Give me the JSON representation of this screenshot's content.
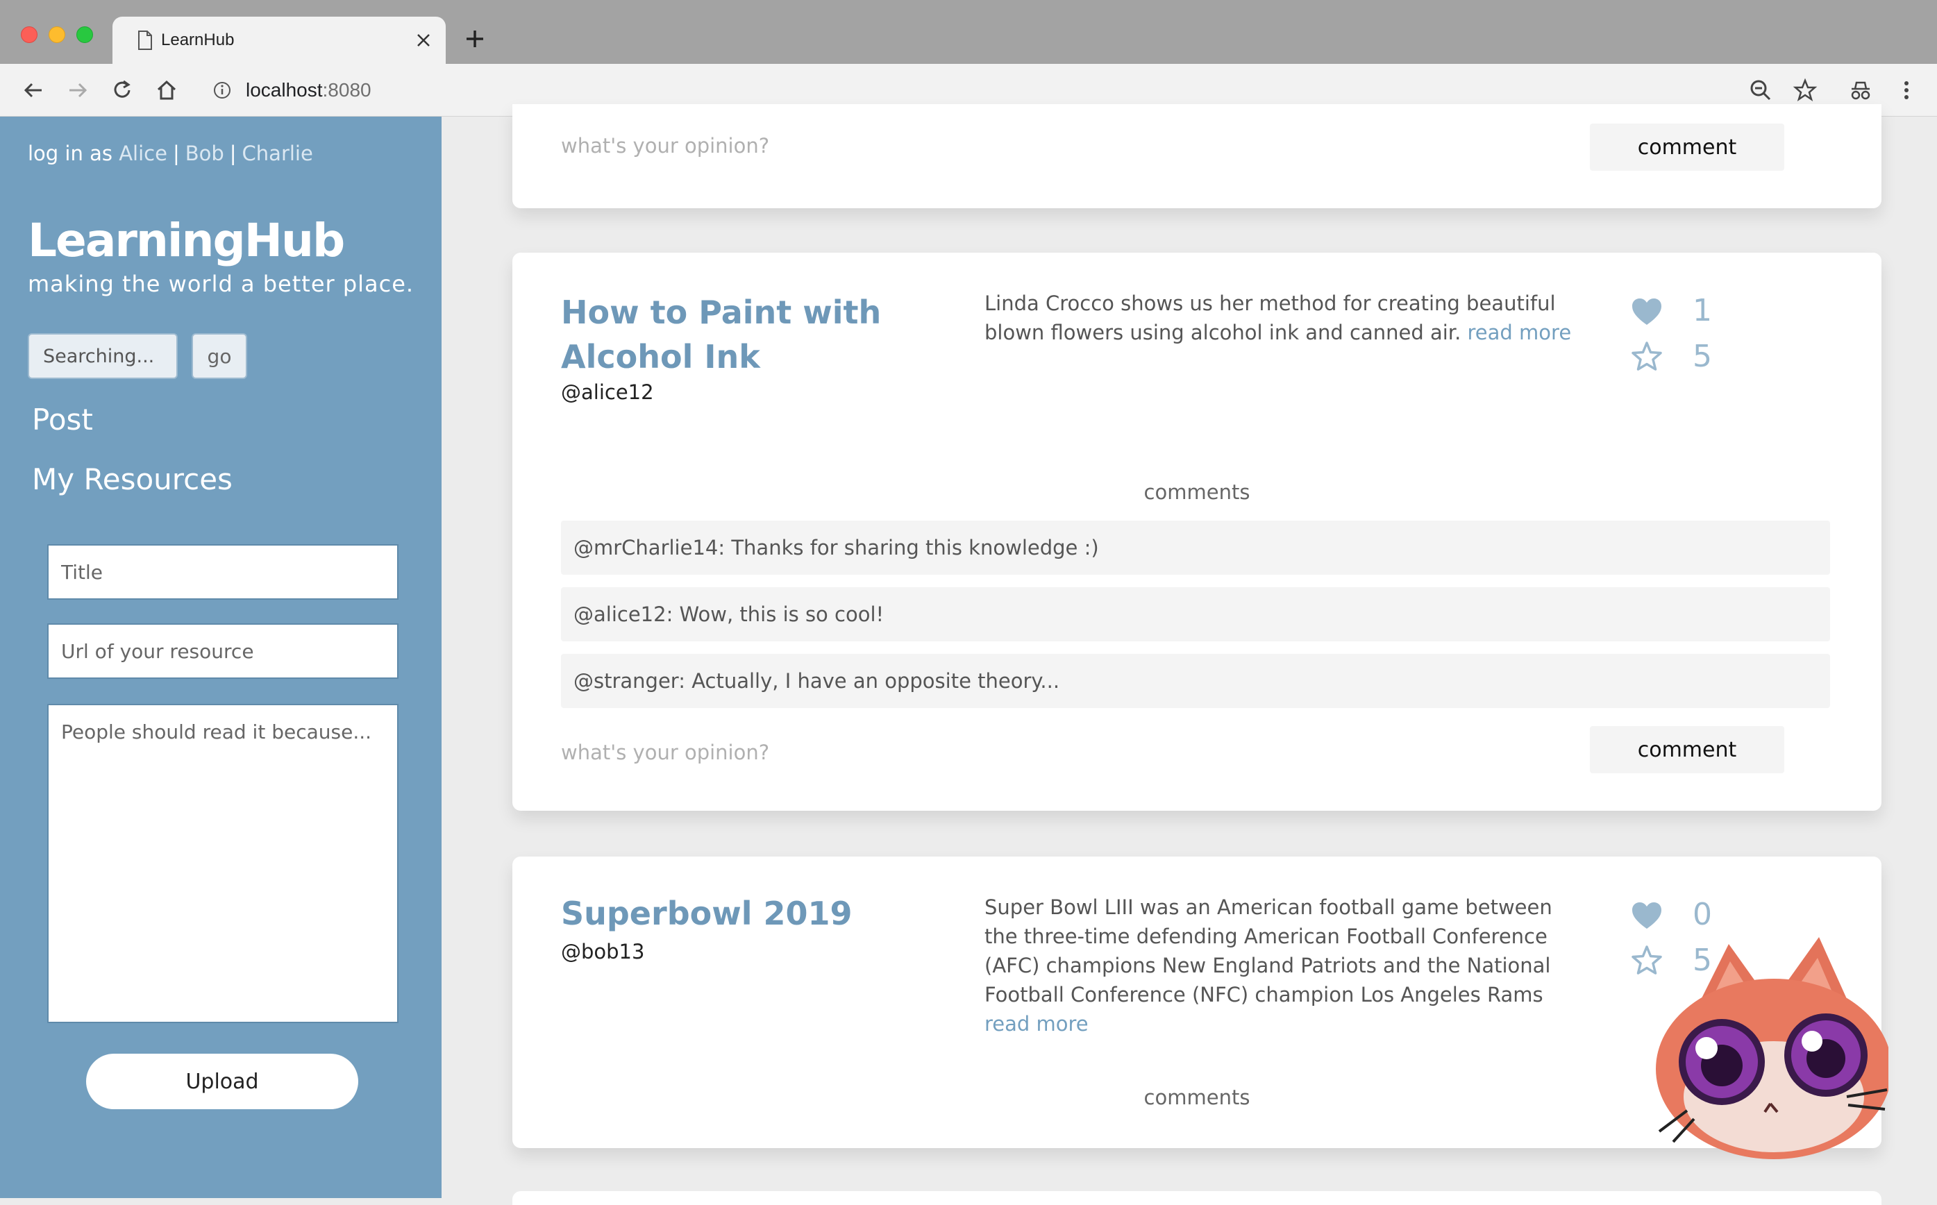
{
  "browser": {
    "tab_title": "LearnHub",
    "url_host": "localhost",
    "url_port": ":8080"
  },
  "sidebar": {
    "login_prefix": "log in as",
    "users": [
      "Alice",
      "Bob",
      "Charlie"
    ],
    "brand_title": "LearningHub",
    "brand_tagline": "making the world a better place.",
    "search_placeholder": "Searching...",
    "go_label": "go",
    "nav_post": "Post",
    "nav_my_resources": "My Resources",
    "form": {
      "title_placeholder": "Title",
      "url_placeholder": "Url of your resource",
      "reason_placeholder": "People should read it because...",
      "upload_label": "Upload"
    }
  },
  "feed": {
    "opinion_placeholder": "what's your opinion?",
    "comment_label": "comment",
    "comments_heading": "comments",
    "read_more": "read more",
    "posts": [
      {
        "title": "How to Paint with Alcohol Ink",
        "author": "@alice12",
        "description": "Linda Crocco shows us her method for creating beautiful blown flowers using alcohol ink and canned air.",
        "likes": "1",
        "stars": "5",
        "comments": [
          "@mrCharlie14: Thanks for sharing this knowledge :)",
          "@alice12: Wow, this is so cool!",
          "@stranger: Actually, I have an opposite theory..."
        ]
      },
      {
        "title": "Superbowl 2019",
        "author": "@bob13",
        "description": "Super Bowl LIII was an American football game between the three-time defending American Football Conference (AFC) champions New England Patriots and the National Football Conference (NFC) champion Los Angeles Rams",
        "likes": "0",
        "stars": "5"
      }
    ]
  },
  "colors": {
    "sidebar_bg": "#739fbf",
    "accent": "#6e98b8",
    "page_bg": "#ececec"
  }
}
